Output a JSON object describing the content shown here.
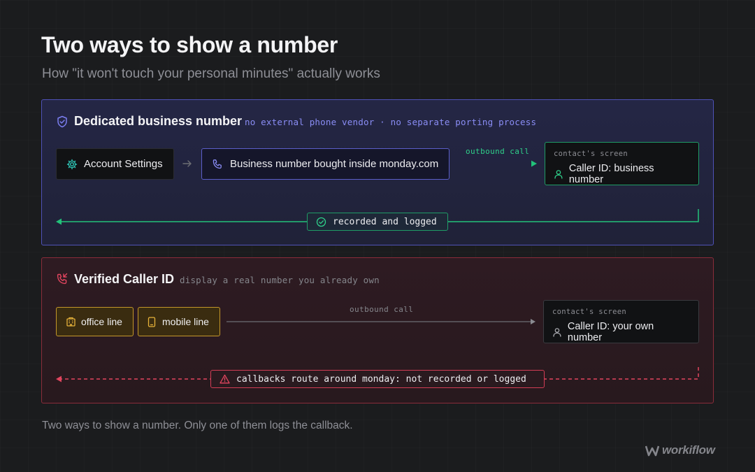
{
  "header": {
    "title": "Two ways to show a number",
    "subtitle": "How \"it won't touch your personal minutes\" actually works"
  },
  "dedicated": {
    "title": "Dedicated business number",
    "note": "no external phone vendor · no separate porting process",
    "settings_label": "Account Settings",
    "number_label": "Business number bought inside monday.com",
    "flow_label": "outbound call",
    "screen_caption": "contact's screen",
    "caller_id": "Caller ID: business number",
    "result_label": "recorded and logged",
    "accent_color": "#5b5ec8",
    "ok_color": "#22c27a",
    "icons": [
      "shield-check-icon",
      "gear-icon",
      "arrow-right-icon",
      "phone-icon",
      "person-icon",
      "check-circle-icon"
    ]
  },
  "verified": {
    "title": "Verified Caller ID",
    "note": "display a real number you already own",
    "office_label": "office line",
    "mobile_label": "mobile line",
    "flow_label": "outbound call",
    "screen_caption": "contact's screen",
    "caller_id": "Caller ID: your own number",
    "warning_label": "callbacks route around monday: not recorded or logged",
    "accent_color": "#d23d55",
    "chip_color": "#c4972a",
    "icons": [
      "phone-incoming-icon",
      "building-icon",
      "mobile-phone-icon",
      "person-icon",
      "warning-icon"
    ]
  },
  "footer": {
    "caption": "Two ways to show a number. Only one of them logs the callback.",
    "brand": "workiflow"
  }
}
